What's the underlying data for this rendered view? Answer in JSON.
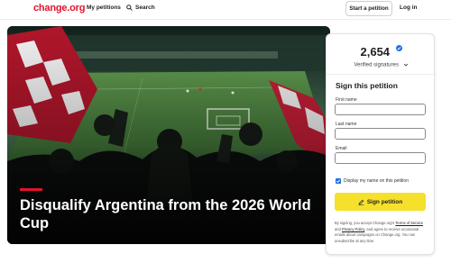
{
  "header": {
    "logo": "change.org",
    "my_petitions": "My petitions",
    "search": "Search",
    "start_petition": "Start a petition",
    "login": "Log in"
  },
  "hero": {
    "title": "Disqualify Argentina from the 2026 World Cup"
  },
  "sign_card": {
    "count": "2,654",
    "verified_label": "Verified signatures",
    "heading": "Sign this petition",
    "first_name_label": "First name",
    "last_name_label": "Last name",
    "email_label": "Email",
    "display_name_label": "Display my name on this petition",
    "display_name_checked": true,
    "sign_button": "Sign petition",
    "legal": {
      "p1": "By signing, you accept Change.org's ",
      "terms": "Terms of Service",
      "p2": " and ",
      "privacy": "Privacy Policy",
      "p3": ", and agree to receive occasional emails about campaigns on Change.org. You can unsubscribe at any time."
    }
  },
  "colors": {
    "brand_red": "#e3122d",
    "sign_button_yellow": "#f5e12b",
    "checkbox_blue": "#1a73e8"
  },
  "icons": {
    "search": "search-icon",
    "verified": "verified-badge-icon",
    "dropdown": "chevron-down-icon",
    "sign": "pen-icon"
  }
}
